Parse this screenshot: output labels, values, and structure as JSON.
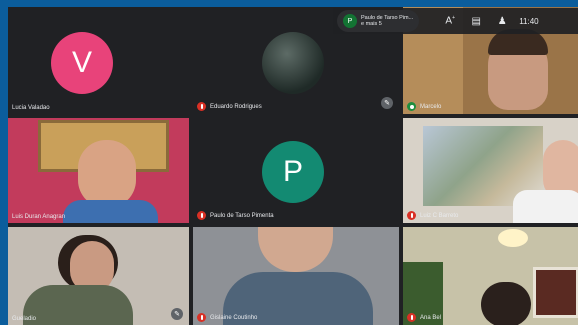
{
  "top_bar": {
    "presenter_initial": "P",
    "presenter_line1": "Paulo de Tarso Pim...",
    "presenter_line2": "e mais 5",
    "time": "11:40"
  },
  "participants": [
    {
      "name": "Lucia Valadao",
      "initial": "V",
      "avatar_color": "#e8437a",
      "muted": false
    },
    {
      "name": "Eduardo Rodrigues",
      "muted": true
    },
    {
      "name": "Marcelo",
      "speaking": true
    },
    {
      "name": "Luis Duran Anagran",
      "muted": false
    },
    {
      "name": "Paulo de Tarso Pimenta",
      "initial": "P",
      "avatar_color": "#138a72",
      "muted": true
    },
    {
      "name": "Luiz C Barreto",
      "muted": true
    },
    {
      "name": "Gueladio",
      "muted": false
    },
    {
      "name": "Gislaine Coutinho",
      "muted": true
    },
    {
      "name": "Ana Bel",
      "muted": true
    }
  ]
}
